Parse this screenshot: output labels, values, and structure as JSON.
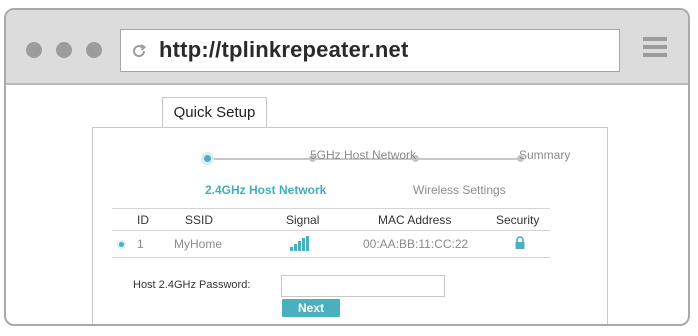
{
  "browser": {
    "url": "http://tplinkrepeater.net"
  },
  "tab": {
    "label": "Quick Setup"
  },
  "steps": [
    {
      "label": "2.4GHz Host Network",
      "active": true
    },
    {
      "label": "5GHz Host Network",
      "active": false
    },
    {
      "label": "Wireless Settings",
      "active": false
    },
    {
      "label": "Summary",
      "active": false
    }
  ],
  "table": {
    "headers": [
      "ID",
      "SSID",
      "Signal",
      "MAC Address",
      "Security"
    ],
    "rows": [
      {
        "id": "1",
        "ssid": "MyHome",
        "signal_icon": "signal-bars-icon",
        "mac": "00:AA:BB:11:CC:22",
        "security_icon": "lock-icon",
        "selected": true
      }
    ]
  },
  "password": {
    "label": "Host 2.4GHz Password:",
    "value": ""
  },
  "next_button": {
    "label": "Next"
  },
  "colors": {
    "accent": "#4ab0bd",
    "chrome": "#dcdcdc",
    "muted_text": "#8a8a8a"
  },
  "icons": {
    "window_controls": [
      "dot-icon",
      "dot-icon",
      "dot-icon"
    ],
    "reload": "reload-icon",
    "menu": "hamburger-menu-icon"
  }
}
